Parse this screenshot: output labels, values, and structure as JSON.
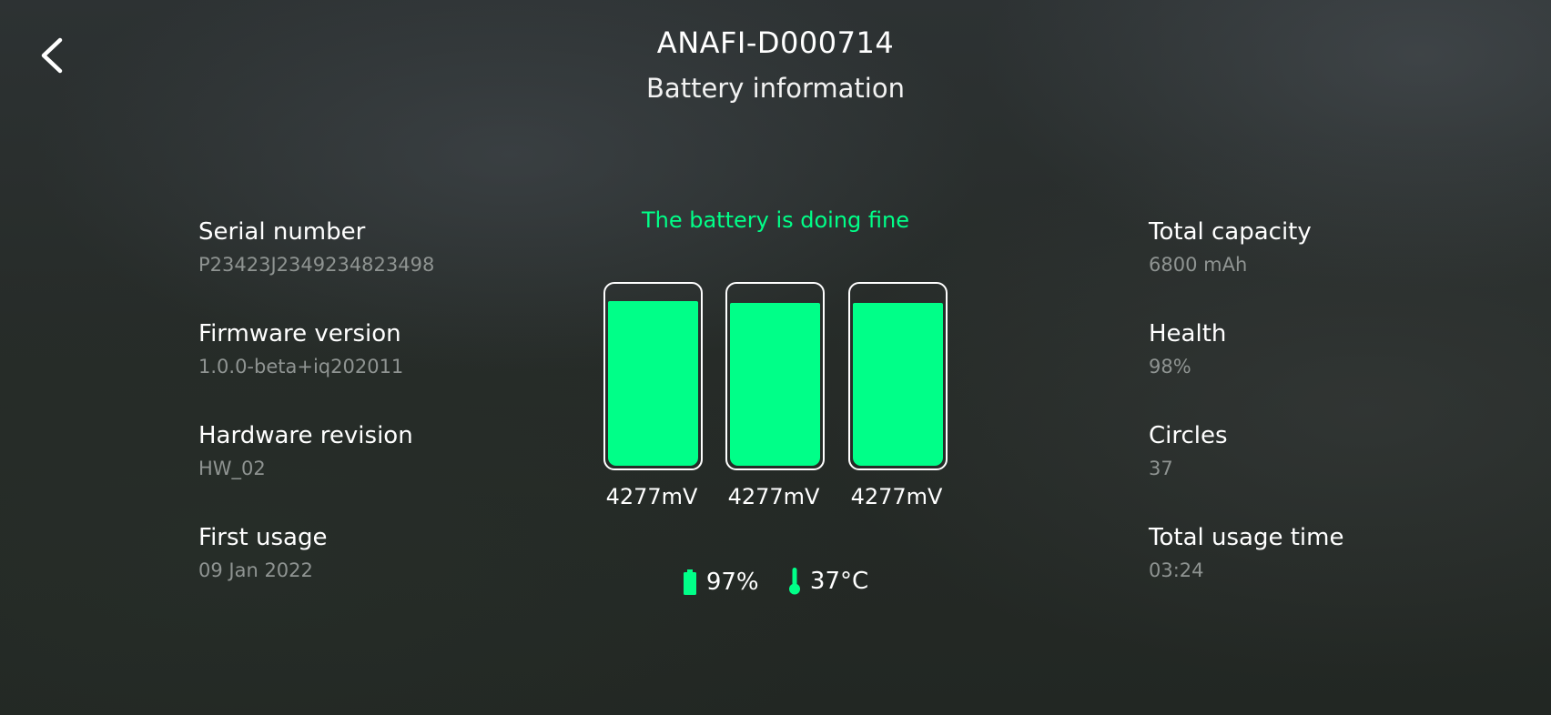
{
  "header": {
    "device_name": "ANAFI-D000714",
    "page_title": "Battery information"
  },
  "left_info": [
    {
      "label": "Serial number",
      "value": "P23423J2349234823498"
    },
    {
      "label": "Firmware version",
      "value": "1.0.0-beta+iq202011"
    },
    {
      "label": "Hardware revision",
      "value": "HW_02"
    },
    {
      "label": "First usage",
      "value": "09 Jan 2022"
    }
  ],
  "right_info": [
    {
      "label": "Total capacity",
      "value": "6800 mAh"
    },
    {
      "label": "Health",
      "value": "98%"
    },
    {
      "label": "Circles",
      "value": "37"
    },
    {
      "label": "Total usage time",
      "value": "03:24"
    }
  ],
  "battery": {
    "status_text": "The battery is doing fine",
    "cells": [
      {
        "voltage": "4277mV",
        "level": 0.94
      },
      {
        "voltage": "4277mV",
        "level": 0.93
      },
      {
        "voltage": "4277mV",
        "level": 0.93
      }
    ],
    "charge": "97%",
    "temperature": "37°C"
  },
  "colors": {
    "accent": "#00ff88",
    "secondary_text": "#8f9492"
  },
  "icons": {
    "back": "chevron-left-icon",
    "battery": "battery-icon",
    "temperature": "thermometer-icon"
  }
}
